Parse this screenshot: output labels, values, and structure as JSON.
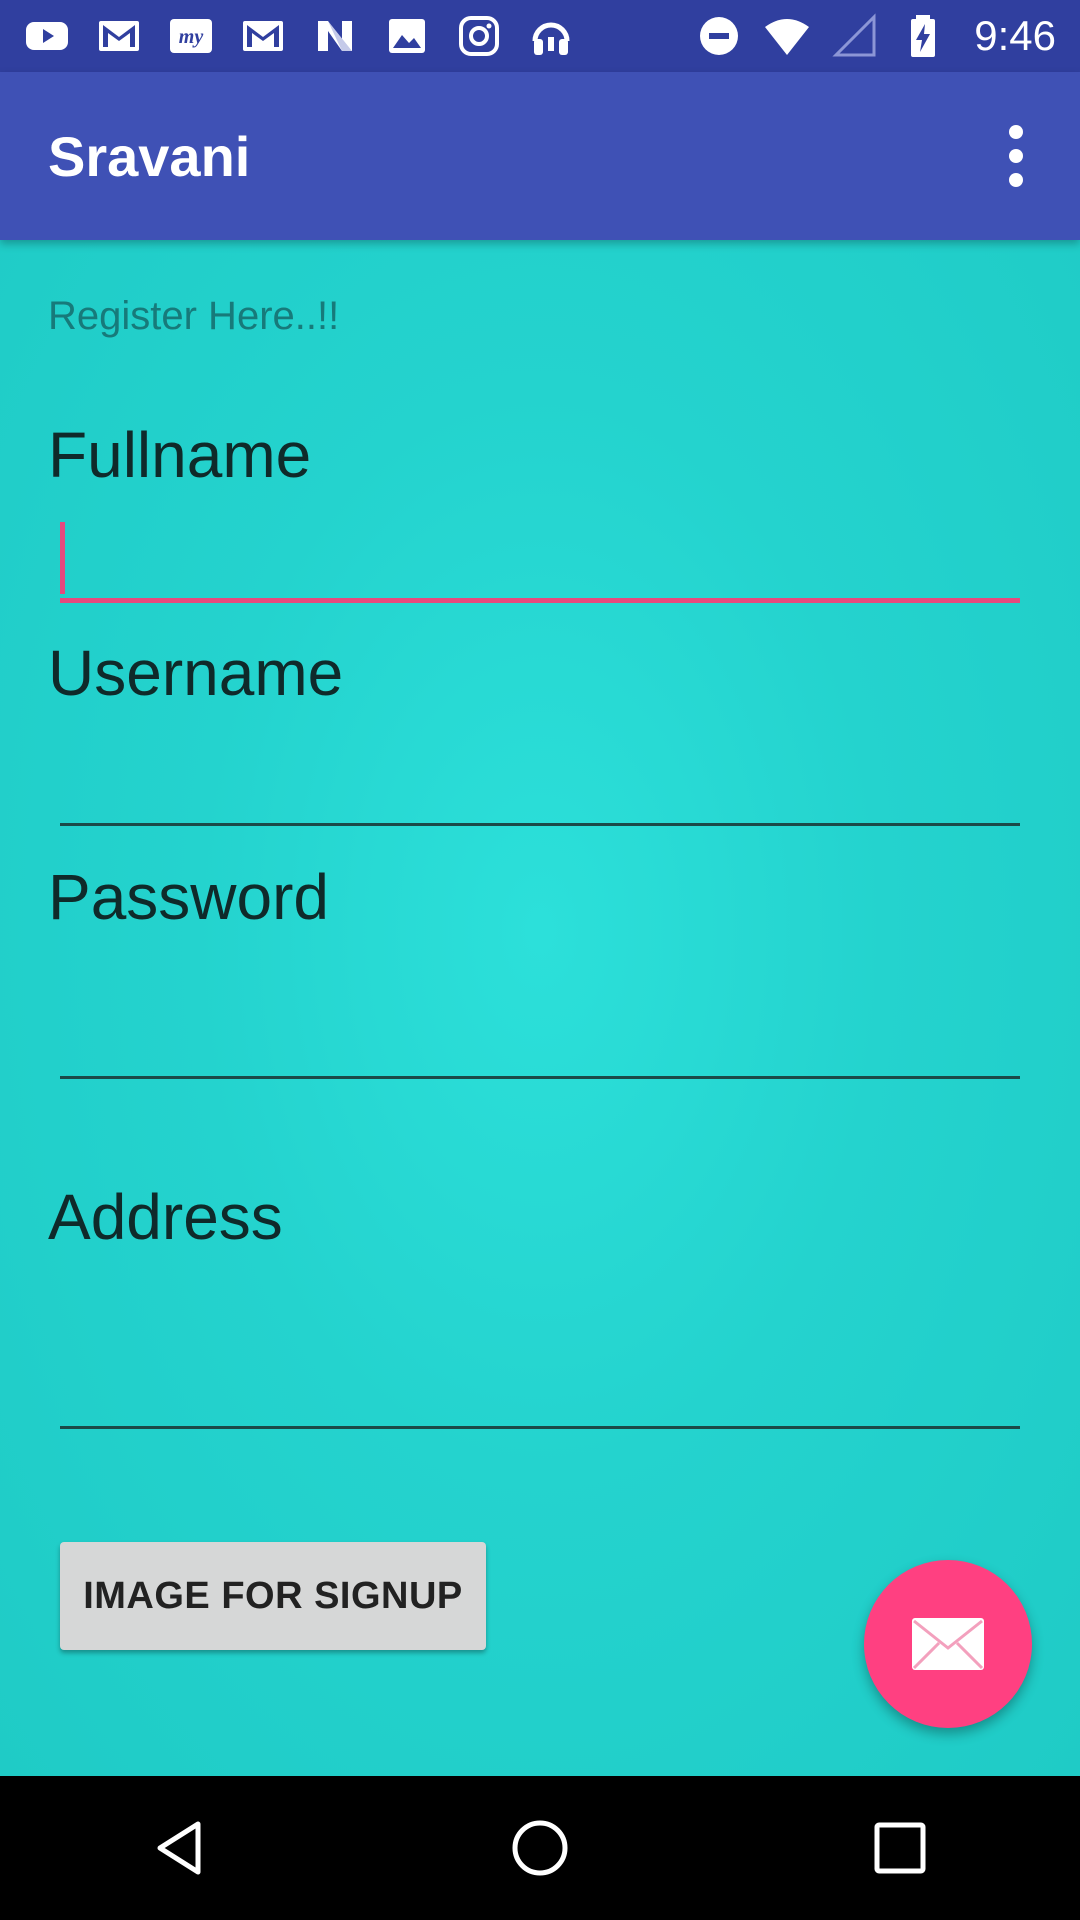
{
  "status_bar": {
    "time": "9:46",
    "left_icons": [
      "youtube-icon",
      "gmail-icon",
      "myntra-icon",
      "gmail-icon",
      "n-icon",
      "gallery-icon",
      "instagram-icon",
      "headphones-icon"
    ],
    "right_icons": [
      "do-not-disturb-icon",
      "wifi-icon",
      "signal-icon",
      "battery-charging-icon"
    ]
  },
  "app_bar": {
    "title": "Sravani",
    "menu_icon": "more-vert-icon"
  },
  "form": {
    "heading": "Register Here..!!",
    "fields": [
      {
        "label": "Fullname",
        "value": ""
      },
      {
        "label": "Username",
        "value": ""
      },
      {
        "label": "Password",
        "value": ""
      },
      {
        "label": "Address",
        "value": ""
      }
    ],
    "signup_button": "IMAGE FOR SIGNUP"
  },
  "fab": {
    "icon": "email-icon"
  },
  "nav_bar": {
    "icons": [
      "back-icon",
      "home-icon",
      "recents-icon"
    ]
  },
  "colors": {
    "status_bar": "#303F9F",
    "app_bar": "#3F51B5",
    "background": "#24D3CE",
    "accent": "#FF4081",
    "focus_line": "#E64A7E"
  }
}
